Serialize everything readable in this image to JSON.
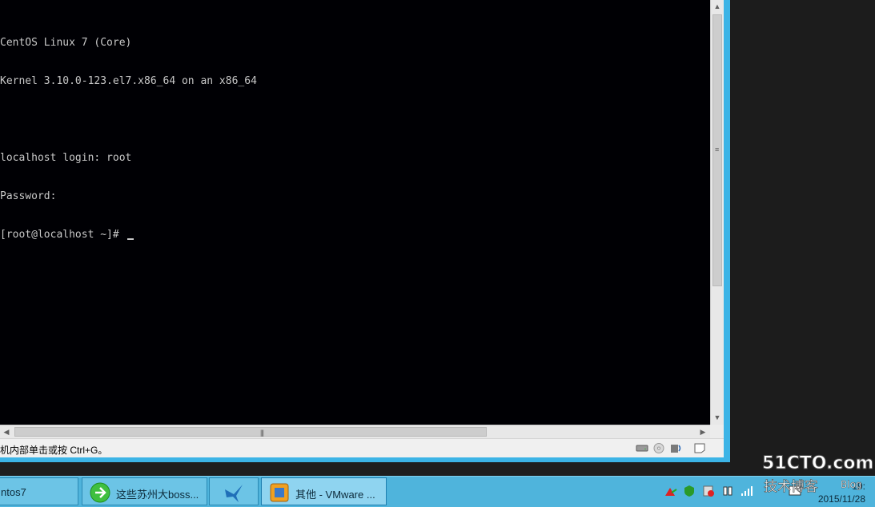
{
  "console": {
    "lines": [
      "CentOS Linux 7 (Core)",
      "Kernel 3.10.0-123.el7.x86_64 on an x86_64",
      "",
      "localhost login: root",
      "Password:",
      "[root@localhost ~]# "
    ]
  },
  "statusbar": {
    "hint": "机内部单击或按 Ctrl+G。"
  },
  "taskbar": {
    "items": [
      {
        "label": "ntos7"
      },
      {
        "label": "这些苏州大boss..."
      },
      {
        "label": ""
      },
      {
        "label": "其他 - VMware ..."
      }
    ],
    "clock": {
      "time": "19:",
      "date": "2015/11/28"
    }
  },
  "watermark": {
    "line1": "51CTO.com",
    "line2": "技术博客",
    "line3": "Blog"
  },
  "colors": {
    "taskbar": "#4fb4dc",
    "console_bg": "#000004",
    "console_fg": "#c8c8c8",
    "window_frame": "#3cb4e6"
  }
}
